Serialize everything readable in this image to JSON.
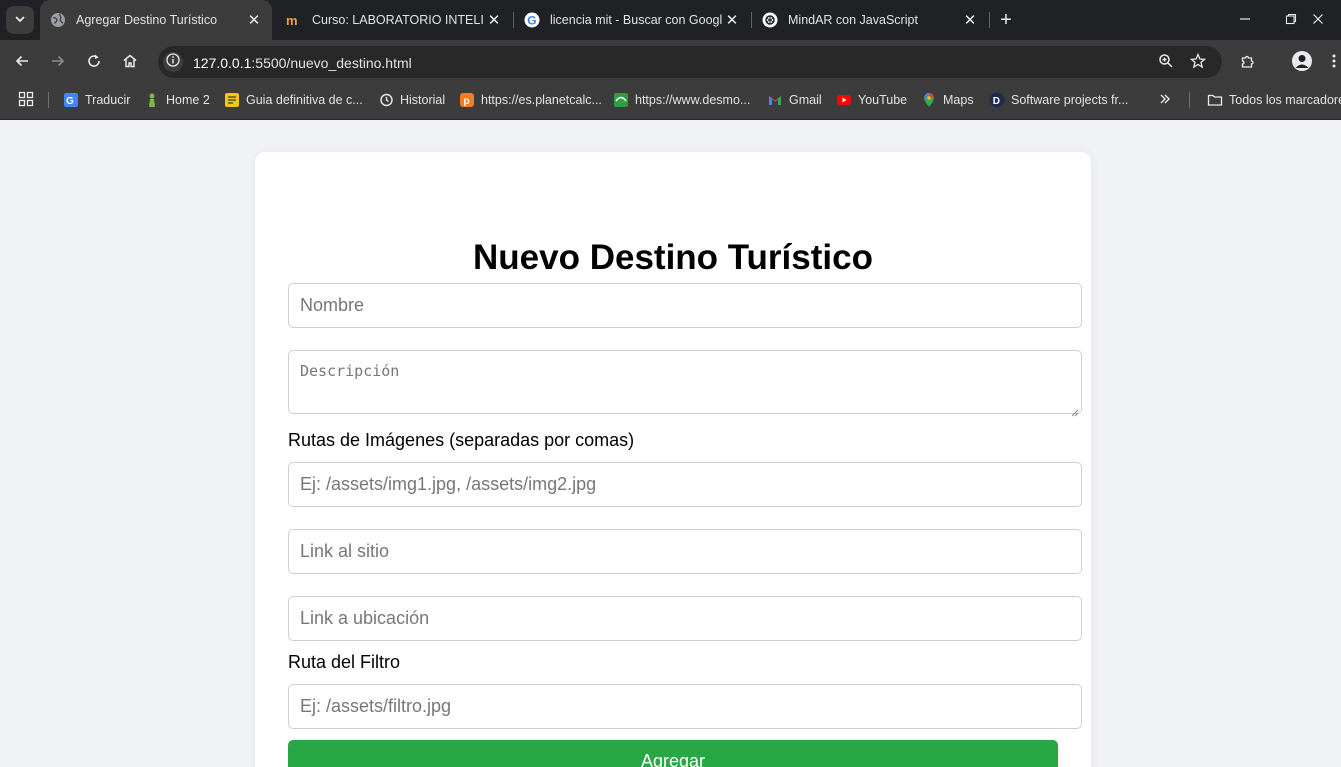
{
  "browser": {
    "tabs": [
      {
        "title": "Agregar Destino Turístico",
        "active": true,
        "icon": "globe-icon"
      },
      {
        "title": "Curso: LABORATORIO INTELIGE",
        "active": false,
        "icon": "course-icon"
      },
      {
        "title": "licencia mit - Buscar con Google",
        "active": false,
        "icon": "google-icon"
      },
      {
        "title": "MindAR con JavaScript",
        "active": false,
        "icon": "openai-icon"
      }
    ],
    "url_host": "127.0.0.1",
    "url_rest": ":5500/nuevo_destino.html",
    "bookmarks": [
      {
        "label": "Traducir",
        "icon": "translate-icon"
      },
      {
        "label": "Home 2",
        "icon": "chess-icon"
      },
      {
        "label": "Guia definitiva de c...",
        "icon": "guide-icon"
      },
      {
        "label": "Historial",
        "icon": "history-icon"
      },
      {
        "label": "https://es.planetcalc...",
        "icon": "planetcalc-icon"
      },
      {
        "label": "https://www.desmo...",
        "icon": "desmos-icon"
      },
      {
        "label": "Gmail",
        "icon": "gmail-icon"
      },
      {
        "label": "YouTube",
        "icon": "youtube-icon"
      },
      {
        "label": "Maps",
        "icon": "maps-icon"
      },
      {
        "label": "Software projects fr...",
        "icon": "d-icon"
      }
    ],
    "all_bookmarks": "Todos los marcadores"
  },
  "form": {
    "title": "Nuevo Destino Turístico",
    "nombre_placeholder": "Nombre",
    "descripcion_placeholder": "Descripción",
    "imagenes_label": "Rutas de Imágenes (separadas por comas)",
    "imagenes_placeholder": "Ej: /assets/img1.jpg, /assets/img2.jpg",
    "sitio_placeholder": "Link al sitio",
    "ubicacion_placeholder": "Link a ubicación",
    "filtro_label": "Ruta del Filtro",
    "filtro_placeholder": "Ej: /assets/filtro.jpg",
    "submit_label": "Agregar"
  },
  "colors": {
    "submit": "#28a745",
    "page_bg": "#f0f2f5",
    "chrome_dark": "#202124",
    "chrome_toolbar": "#3c3c3c"
  }
}
